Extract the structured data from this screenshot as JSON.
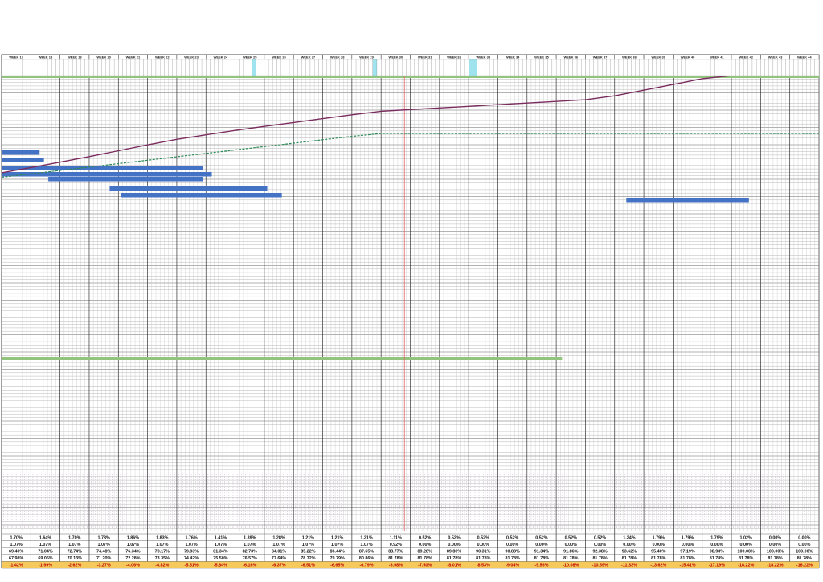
{
  "chart_data": {
    "type": "gantt-s-curve",
    "weeks": [
      "WEEK 17",
      "WEEK 18",
      "WEEK 19",
      "WEEK 20",
      "WEEK 21",
      "WEEK 22",
      "WEEK 23",
      "WEEK 24",
      "WEEK 25",
      "WEEK 26",
      "WEEK 27",
      "WEEK 28",
      "WEEK 29",
      "WEEK 30",
      "WEEK 31",
      "WEEK 32",
      "WEEK 33",
      "WEEK 34",
      "WEEK 35",
      "WEEK 36",
      "WEEK 37",
      "WEEK 38",
      "WEEK 39",
      "WEEK 40",
      "WEEK 41",
      "WEEK 42",
      "WEEK 43",
      "WEEK 44"
    ],
    "current_week_index": 13.8,
    "summary_rows": [
      {
        "name": "weekly_planned",
        "values": [
          "1.70%",
          "1.64%",
          "1.70%",
          "1.73%",
          "1.86%",
          "1.83%",
          "1.76%",
          "1.41%",
          "1.39%",
          "1.28%",
          "1.21%",
          "1.21%",
          "1.21%",
          "1.11%",
          "0.52%",
          "0.52%",
          "0.52%",
          "0.52%",
          "0.52%",
          "0.52%",
          "0.52%",
          "1.24%",
          "1.79%",
          "1.79%",
          "1.79%",
          "1.02%",
          "0.00%",
          "0.00%"
        ]
      },
      {
        "name": "weekly_actual",
        "values": [
          "1.07%",
          "1.07%",
          "1.07%",
          "1.07%",
          "1.07%",
          "1.07%",
          "1.07%",
          "1.07%",
          "1.07%",
          "1.07%",
          "1.07%",
          "1.07%",
          "1.07%",
          "0.92%",
          "0.00%",
          "0.00%",
          "0.00%",
          "0.00%",
          "0.00%",
          "0.00%",
          "0.00%",
          "0.00%",
          "0.00%",
          "0.00%",
          "0.00%",
          "0.00%",
          "0.00%",
          "0.00%"
        ]
      },
      {
        "name": "cumulative_planned",
        "values": [
          "69.40%",
          "71.04%",
          "72.74%",
          "74.48%",
          "76.34%",
          "78.17%",
          "79.93%",
          "81.34%",
          "82.73%",
          "84.01%",
          "85.22%",
          "86.44%",
          "87.65%",
          "88.77%",
          "89.28%",
          "89.80%",
          "90.31%",
          "90.83%",
          "91.34%",
          "91.86%",
          "92.38%",
          "93.62%",
          "95.40%",
          "97.19%",
          "98.98%",
          "100.00%",
          "100.00%",
          "100.00%"
        ]
      },
      {
        "name": "cumulative_actual",
        "values": [
          "67.98%",
          "69.05%",
          "70.13%",
          "71.20%",
          "72.28%",
          "73.35%",
          "74.42%",
          "75.50%",
          "76.57%",
          "77.64%",
          "78.72%",
          "79.79%",
          "80.86%",
          "81.78%",
          "81.78%",
          "81.78%",
          "81.78%",
          "81.78%",
          "81.78%",
          "81.78%",
          "81.78%",
          "81.78%",
          "81.78%",
          "81.78%",
          "81.78%",
          "81.78%",
          "81.78%",
          "81.78%"
        ]
      },
      {
        "name": "variance",
        "values": [
          "-1.42%",
          "-1.99%",
          "-2.62%",
          "-3.27%",
          "-4.06%",
          "-4.82%",
          "-5.51%",
          "-5.84%",
          "-6.16%",
          "-6.37%",
          "-6.51%",
          "-6.65%",
          "-6.79%",
          "-6.98%",
          "-7.50%",
          "-8.01%",
          "-8.53%",
          "-9.04%",
          "-9.56%",
          "-10.08%",
          "-10.59%",
          "-11.83%",
          "-13.62%",
          "-15.41%",
          "-17.19%",
          "-18.22%",
          "-18.22%",
          "-18.22%"
        ]
      }
    ],
    "bars": [
      {
        "start": 0,
        "end": 1.3,
        "row": 0
      },
      {
        "start": 0,
        "end": 1.45,
        "row": 1
      },
      {
        "start": 0,
        "end": 6.9,
        "row": 2
      },
      {
        "start": 0,
        "end": 7.2,
        "row": 3
      },
      {
        "start": 1.6,
        "end": 6.9,
        "row": 4
      },
      {
        "start": 3.7,
        "end": 9.1,
        "row": 5
      },
      {
        "start": 4.1,
        "end": 9.6,
        "row": 6
      },
      {
        "start": 21.4,
        "end": 25.6,
        "row": 7
      }
    ],
    "ylim": [
      0,
      100
    ],
    "colors": {
      "bar": "#4472c4",
      "planned_line": "#7b2c5f",
      "actual_line": "#2e8b57",
      "today_line": "#e06666",
      "band": "#93c47d",
      "variance": "#c00000",
      "variance_bg": "#f6c95c"
    }
  }
}
